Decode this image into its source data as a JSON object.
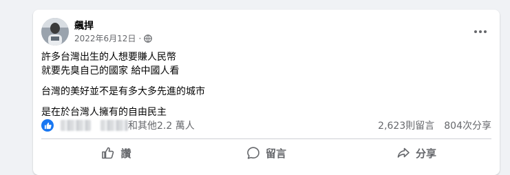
{
  "post": {
    "author": "飆捍",
    "date": "2022年6月12日",
    "visibility_icon": "globe-icon",
    "more_icon": "more-horizontal-icon",
    "text_lines": [
      "許多台灣出生的人想要賺人民幣",
      "就要先臭自己的國家 給中國人看",
      "台灣的美好並不是有多大多先進的城市",
      "是在於台灣人擁有的自由民主"
    ]
  },
  "stats": {
    "reaction_icon": "like-icon",
    "reactions_text": "和其他2.2 萬人",
    "comments": "2,623則留言",
    "shares": "804次分享"
  },
  "actions": {
    "like": "讚",
    "comment": "留言",
    "share": "分享"
  },
  "colors": {
    "accent": "#1877f2",
    "secondary_text": "#65676b",
    "background": "#f0f2f5"
  }
}
